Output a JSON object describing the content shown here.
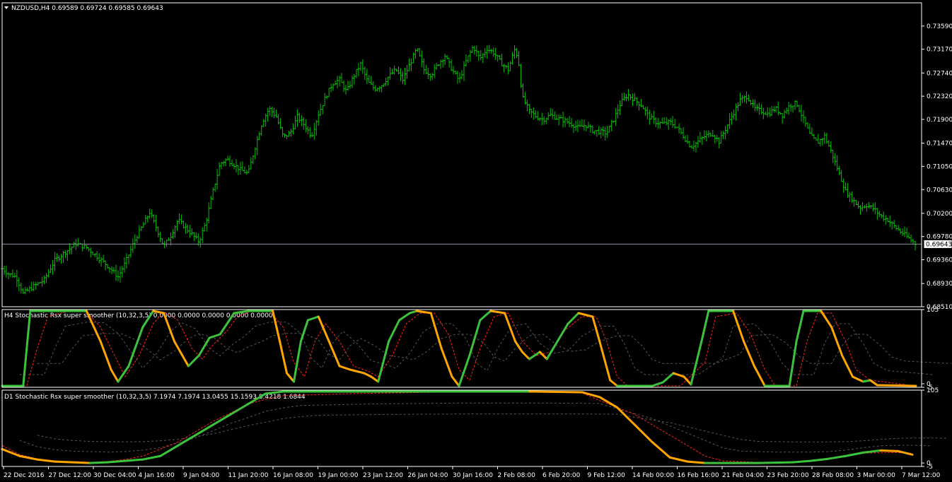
{
  "chart_data": [
    {
      "type": "candlestick",
      "title": "NZDUSD,H4  0.69589 0.69724 0.69585 0.69643",
      "series_color": "#00c000",
      "current_price": 0.69643,
      "current_price_label": "0.69643",
      "ylim": [
        0.6851,
        0.7401
      ],
      "y_ticks": [
        "0.73590",
        "0.73170",
        "0.72740",
        "0.72320",
        "0.71900",
        "0.71470",
        "0.71050",
        "0.70630",
        "0.70200",
        "0.69780",
        "0.69360",
        "0.68930",
        "0.68510"
      ],
      "close_path": [
        [
          0,
          0.692
        ],
        [
          4,
          0.691
        ],
        [
          8,
          0.6905
        ],
        [
          12,
          0.6875
        ],
        [
          18,
          0.6888
        ],
        [
          24,
          0.69
        ],
        [
          30,
          0.6935
        ],
        [
          36,
          0.695
        ],
        [
          42,
          0.6965
        ],
        [
          48,
          0.6958
        ],
        [
          54,
          0.6942
        ],
        [
          60,
          0.6925
        ],
        [
          66,
          0.6905
        ],
        [
          70,
          0.693
        ],
        [
          76,
          0.6975
        ],
        [
          80,
          0.6998
        ],
        [
          84,
          0.7022
        ],
        [
          88,
          0.6992
        ],
        [
          92,
          0.696
        ],
        [
          96,
          0.698
        ],
        [
          100,
          0.7008
        ],
        [
          104,
          0.6995
        ],
        [
          108,
          0.6982
        ],
        [
          112,
          0.6968
        ],
        [
          116,
          0.7005
        ],
        [
          120,
          0.706
        ],
        [
          124,
          0.711
        ],
        [
          128,
          0.7118
        ],
        [
          132,
          0.7108
        ],
        [
          136,
          0.7098
        ],
        [
          140,
          0.7092
        ],
        [
          144,
          0.714
        ],
        [
          148,
          0.7185
        ],
        [
          152,
          0.721
        ],
        [
          156,
          0.7195
        ],
        [
          160,
          0.7158
        ],
        [
          164,
          0.7165
        ],
        [
          168,
          0.7195
        ],
        [
          172,
          0.718
        ],
        [
          176,
          0.716
        ],
        [
          180,
          0.72
        ],
        [
          184,
          0.723
        ],
        [
          188,
          0.7255
        ],
        [
          192,
          0.7262
        ],
        [
          196,
          0.724
        ],
        [
          200,
          0.7268
        ],
        [
          204,
          0.729
        ],
        [
          208,
          0.7258
        ],
        [
          212,
          0.7245
        ],
        [
          216,
          0.7252
        ],
        [
          220,
          0.7268
        ],
        [
          224,
          0.728
        ],
        [
          228,
          0.7262
        ],
        [
          232,
          0.729
        ],
        [
          236,
          0.7318
        ],
        [
          240,
          0.728
        ],
        [
          244,
          0.727
        ],
        [
          248,
          0.729
        ],
        [
          252,
          0.7305
        ],
        [
          256,
          0.728
        ],
        [
          260,
          0.726
        ],
        [
          264,
          0.7295
        ],
        [
          268,
          0.7322
        ],
        [
          272,
          0.73
        ],
        [
          276,
          0.7318
        ],
        [
          280,
          0.731
        ],
        [
          284,
          0.7292
        ],
        [
          288,
          0.728
        ],
        [
          292,
          0.732
        ],
        [
          294,
          0.729
        ],
        [
          296,
          0.723
        ],
        [
          300,
          0.7205
        ],
        [
          304,
          0.7195
        ],
        [
          308,
          0.719
        ],
        [
          312,
          0.7198
        ],
        [
          316,
          0.7192
        ],
        [
          320,
          0.7188
        ],
        [
          324,
          0.7182
        ],
        [
          328,
          0.7175
        ],
        [
          332,
          0.718
        ],
        [
          336,
          0.717
        ],
        [
          340,
          0.7168
        ],
        [
          344,
          0.7165
        ],
        [
          348,
          0.719
        ],
        [
          352,
          0.722
        ],
        [
          356,
          0.7235
        ],
        [
          360,
          0.7225
        ],
        [
          364,
          0.7215
        ],
        [
          368,
          0.7195
        ],
        [
          372,
          0.7185
        ],
        [
          376,
          0.7182
        ],
        [
          380,
          0.7185
        ],
        [
          384,
          0.7176
        ],
        [
          388,
          0.7158
        ],
        [
          392,
          0.714
        ],
        [
          396,
          0.715
        ],
        [
          400,
          0.716
        ],
        [
          404,
          0.7165
        ],
        [
          408,
          0.715
        ],
        [
          412,
          0.7175
        ],
        [
          416,
          0.72
        ],
        [
          420,
          0.7225
        ],
        [
          424,
          0.7232
        ],
        [
          428,
          0.721
        ],
        [
          432,
          0.7205
        ],
        [
          436,
          0.72
        ],
        [
          440,
          0.721
        ],
        [
          444,
          0.7198
        ],
        [
          448,
          0.7215
        ],
        [
          452,
          0.722
        ],
        [
          456,
          0.719
        ],
        [
          460,
          0.716
        ],
        [
          464,
          0.7148
        ],
        [
          468,
          0.716
        ],
        [
          472,
          0.713
        ],
        [
          476,
          0.7095
        ],
        [
          480,
          0.706
        ],
        [
          484,
          0.7045
        ],
        [
          488,
          0.703
        ],
        [
          492,
          0.7035
        ],
        [
          496,
          0.7028
        ],
        [
          500,
          0.7015
        ],
        [
          504,
          0.7008
        ],
        [
          508,
          0.6995
        ],
        [
          512,
          0.6985
        ],
        [
          516,
          0.6975
        ],
        [
          520,
          0.6964
        ]
      ],
      "x_ticks": [
        "22 Dec 2016",
        "27 Dec 12:00",
        "30 Dec 04:00",
        "4 Jan 16:00",
        "9 Jan 04:00",
        "11 Jan 20:00",
        "16 Jan 08:00",
        "19 Jan 00:00",
        "23 Jan 12:00",
        "26 Jan 04:00",
        "30 Jan 16:00",
        "2 Feb 08:00",
        "6 Feb 20:00",
        "9 Feb 12:00",
        "14 Feb 00:00",
        "16 Feb 16:00",
        "21 Feb 04:00",
        "23 Feb 20:00",
        "28 Feb 08:00",
        "3 Mar 00:00",
        "7 Mar 12:00"
      ]
    },
    {
      "type": "line",
      "title": "H4 Stochastic Rsx super smoother (10,32,3,5) 0.0000 0.0000 0.0000 0.0000 0.0000",
      "ylim": [
        -5,
        105
      ],
      "y_ticks": [
        "105",
        "0",
        "-5"
      ],
      "main_line": [
        [
          0,
          -3
        ],
        [
          12,
          -3
        ],
        [
          16,
          103
        ],
        [
          24,
          103
        ],
        [
          40,
          103
        ],
        [
          48,
          103
        ],
        [
          56,
          60
        ],
        [
          62,
          20
        ],
        [
          66,
          3
        ],
        [
          72,
          25
        ],
        [
          80,
          80
        ],
        [
          86,
          103
        ],
        [
          92,
          100
        ],
        [
          98,
          60
        ],
        [
          106,
          25
        ],
        [
          112,
          40
        ],
        [
          118,
          65
        ],
        [
          124,
          70
        ],
        [
          132,
          100
        ],
        [
          140,
          103
        ],
        [
          148,
          103
        ],
        [
          154,
          103
        ],
        [
          158,
          60
        ],
        [
          162,
          15
        ],
        [
          166,
          3
        ],
        [
          170,
          60
        ],
        [
          174,
          90
        ],
        [
          180,
          95
        ],
        [
          186,
          60
        ],
        [
          192,
          25
        ],
        [
          198,
          20
        ],
        [
          206,
          15
        ],
        [
          210,
          10
        ],
        [
          214,
          3
        ],
        [
          220,
          60
        ],
        [
          226,
          90
        ],
        [
          232,
          100
        ],
        [
          236,
          103
        ],
        [
          244,
          100
        ],
        [
          250,
          50
        ],
        [
          256,
          10
        ],
        [
          260,
          -3
        ],
        [
          266,
          40
        ],
        [
          272,
          90
        ],
        [
          278,
          103
        ],
        [
          286,
          100
        ],
        [
          292,
          60
        ],
        [
          296,
          45
        ],
        [
          300,
          35
        ],
        [
          306,
          45
        ],
        [
          310,
          35
        ],
        [
          316,
          60
        ],
        [
          322,
          85
        ],
        [
          328,
          100
        ],
        [
          336,
          95
        ],
        [
          340,
          60
        ],
        [
          346,
          5
        ],
        [
          350,
          -3
        ],
        [
          360,
          -3
        ],
        [
          370,
          -3
        ],
        [
          376,
          2
        ],
        [
          382,
          15
        ],
        [
          388,
          10
        ],
        [
          392,
          -1
        ],
        [
          398,
          60
        ],
        [
          402,
          103
        ],
        [
          416,
          103
        ],
        [
          422,
          60
        ],
        [
          428,
          25
        ],
        [
          434,
          -3
        ],
        [
          442,
          -3
        ],
        [
          448,
          -3
        ],
        [
          452,
          60
        ],
        [
          456,
          103
        ],
        [
          466,
          103
        ],
        [
          472,
          80
        ],
        [
          478,
          40
        ],
        [
          484,
          10
        ],
        [
          490,
          3
        ],
        [
          494,
          5
        ],
        [
          498,
          -2
        ],
        [
          520,
          -3
        ]
      ],
      "signal_line": [
        [
          0,
          -3
        ],
        [
          14,
          -3
        ],
        [
          20,
          50
        ],
        [
          26,
          95
        ],
        [
          38,
          103
        ],
        [
          48,
          102
        ],
        [
          56,
          80
        ],
        [
          64,
          40
        ],
        [
          70,
          10
        ],
        [
          78,
          40
        ],
        [
          86,
          85
        ],
        [
          92,
          102
        ],
        [
          100,
          90
        ],
        [
          108,
          50
        ],
        [
          114,
          35
        ],
        [
          120,
          55
        ],
        [
          128,
          75
        ],
        [
          134,
          95
        ],
        [
          142,
          103
        ],
        [
          152,
          103
        ],
        [
          160,
          80
        ],
        [
          166,
          30
        ],
        [
          172,
          10
        ],
        [
          178,
          60
        ],
        [
          184,
          85
        ],
        [
          192,
          60
        ],
        [
          200,
          25
        ],
        [
          208,
          18
        ],
        [
          214,
          10
        ],
        [
          222,
          40
        ],
        [
          230,
          85
        ],
        [
          238,
          100
        ],
        [
          246,
          100
        ],
        [
          254,
          70
        ],
        [
          260,
          20
        ],
        [
          266,
          5
        ],
        [
          272,
          50
        ],
        [
          280,
          95
        ],
        [
          288,
          100
        ],
        [
          296,
          60
        ],
        [
          304,
          40
        ],
        [
          312,
          45
        ],
        [
          320,
          75
        ],
        [
          330,
          95
        ],
        [
          338,
          95
        ],
        [
          344,
          60
        ],
        [
          350,
          10
        ],
        [
          356,
          -3
        ],
        [
          386,
          -3
        ],
        [
          400,
          30
        ],
        [
          406,
          95
        ],
        [
          418,
          100
        ],
        [
          426,
          70
        ],
        [
          434,
          20
        ],
        [
          440,
          -3
        ],
        [
          452,
          -3
        ],
        [
          458,
          60
        ],
        [
          464,
          100
        ],
        [
          472,
          100
        ],
        [
          480,
          60
        ],
        [
          486,
          20
        ],
        [
          494,
          5
        ],
        [
          520,
          -3
        ]
      ]
    },
    {
      "type": "line",
      "title": "D1 Stochastic Rsx super smoother (10,32,3,5) 7.1974 7.1974 13.0455 15.1593 8.4218 1.6844",
      "ylim": [
        -5,
        105
      ],
      "y_ticks": [
        "105",
        "0",
        "-5"
      ],
      "main_line": [
        [
          0,
          20
        ],
        [
          10,
          10
        ],
        [
          20,
          5
        ],
        [
          30,
          2
        ],
        [
          40,
          1
        ],
        [
          50,
          0
        ],
        [
          60,
          1
        ],
        [
          70,
          3
        ],
        [
          80,
          5
        ],
        [
          90,
          10
        ],
        [
          100,
          25
        ],
        [
          110,
          40
        ],
        [
          120,
          55
        ],
        [
          130,
          70
        ],
        [
          140,
          85
        ],
        [
          150,
          100
        ],
        [
          160,
          103
        ],
        [
          200,
          103
        ],
        [
          250,
          103
        ],
        [
          300,
          103
        ],
        [
          330,
          102
        ],
        [
          340,
          95
        ],
        [
          350,
          80
        ],
        [
          360,
          55
        ],
        [
          370,
          30
        ],
        [
          380,
          8
        ],
        [
          390,
          2
        ],
        [
          400,
          0
        ],
        [
          430,
          0
        ],
        [
          450,
          1
        ],
        [
          460,
          3
        ],
        [
          470,
          6
        ],
        [
          480,
          10
        ],
        [
          490,
          15
        ],
        [
          500,
          18
        ],
        [
          510,
          17
        ],
        [
          518,
          12
        ]
      ],
      "signal_line": [
        [
          0,
          25
        ],
        [
          10,
          12
        ],
        [
          20,
          6
        ],
        [
          30,
          3
        ],
        [
          40,
          2
        ],
        [
          50,
          1
        ],
        [
          60,
          2
        ],
        [
          70,
          5
        ],
        [
          80,
          10
        ],
        [
          90,
          20
        ],
        [
          100,
          30
        ],
        [
          110,
          45
        ],
        [
          120,
          60
        ],
        [
          130,
          72
        ],
        [
          140,
          85
        ],
        [
          150,
          92
        ],
        [
          160,
          97
        ],
        [
          200,
          100
        ],
        [
          250,
          102
        ],
        [
          300,
          102
        ],
        [
          330,
          101
        ],
        [
          340,
          90
        ],
        [
          350,
          80
        ],
        [
          360,
          70
        ],
        [
          370,
          55
        ],
        [
          380,
          40
        ],
        [
          390,
          25
        ],
        [
          400,
          10
        ],
        [
          410,
          3
        ],
        [
          430,
          1
        ],
        [
          450,
          1
        ],
        [
          460,
          2
        ],
        [
          470,
          5
        ],
        [
          480,
          10
        ],
        [
          490,
          14
        ],
        [
          500,
          15
        ],
        [
          510,
          15
        ],
        [
          518,
          14
        ]
      ]
    }
  ]
}
